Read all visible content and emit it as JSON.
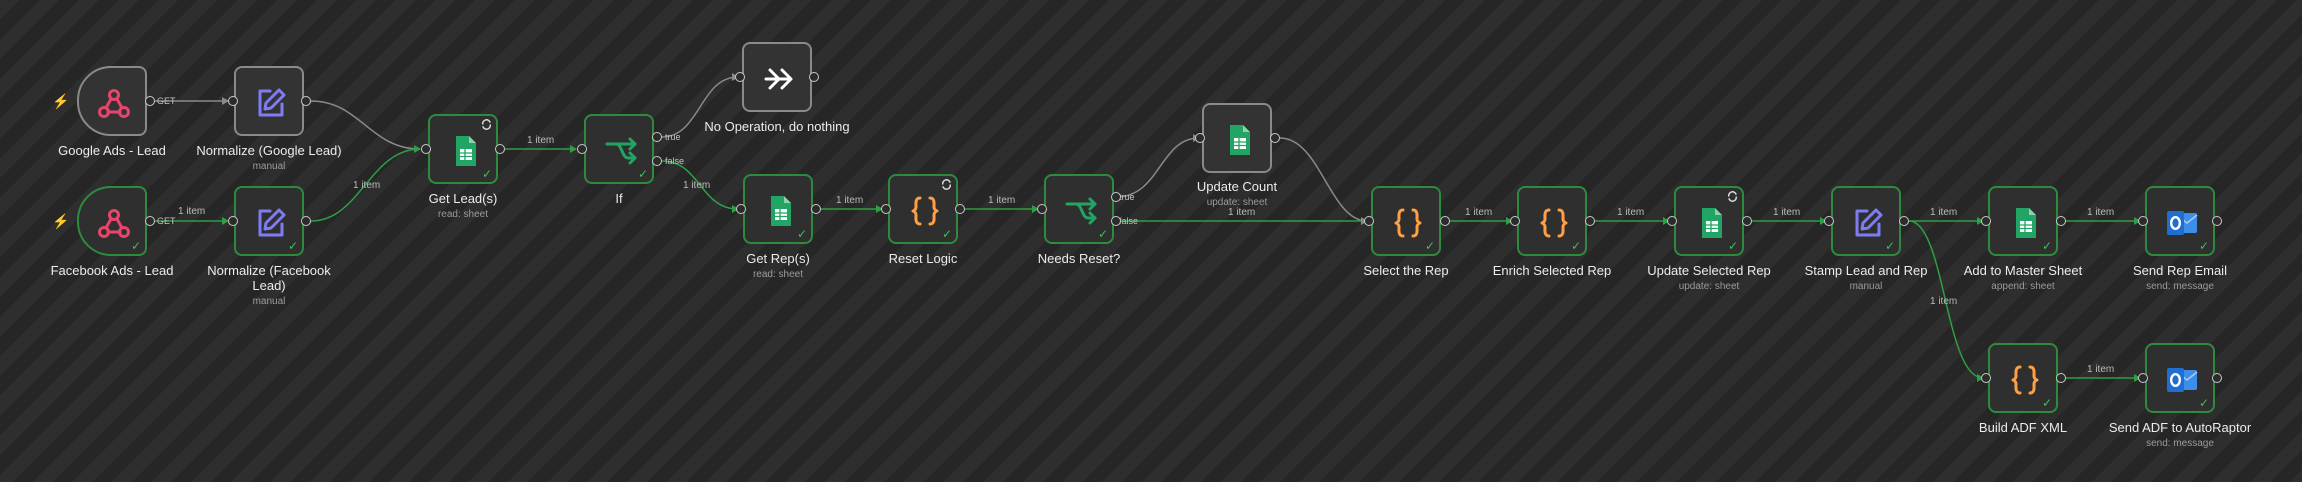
{
  "nodes": {
    "google_ads_lead": {
      "title": "Google Ads - Lead",
      "icon": "webhook-icon"
    },
    "normalize_google": {
      "title": "Normalize (Google Lead)",
      "subtitle": "manual",
      "icon": "edit-icon"
    },
    "facebook_ads_lead": {
      "title": "Facebook Ads - Lead",
      "icon": "webhook-icon"
    },
    "normalize_facebook": {
      "title": "Normalize (Facebook Lead)",
      "subtitle": "manual",
      "icon": "edit-icon"
    },
    "get_leads": {
      "title": "Get Lead(s)",
      "subtitle": "read: sheet",
      "icon": "google-sheets-icon"
    },
    "if": {
      "title": "If",
      "icon": "if-branch-icon"
    },
    "no_operation": {
      "title": "No Operation, do nothing",
      "icon": "arrow-forward-icon"
    },
    "get_reps": {
      "title": "Get Rep(s)",
      "subtitle": "read: sheet",
      "icon": "google-sheets-icon"
    },
    "reset_logic": {
      "title": "Reset Logic",
      "icon": "code-braces-icon"
    },
    "needs_reset": {
      "title": "Needs Reset?",
      "icon": "if-branch-icon"
    },
    "update_count": {
      "title": "Update Count",
      "subtitle": "update: sheet",
      "icon": "google-sheets-icon"
    },
    "select_rep": {
      "title": "Select the Rep",
      "icon": "code-braces-icon"
    },
    "enrich_rep": {
      "title": "Enrich Selected Rep",
      "icon": "code-braces-icon"
    },
    "update_selected_rep": {
      "title": "Update Selected Rep",
      "subtitle": "update: sheet",
      "icon": "google-sheets-icon"
    },
    "stamp_lead": {
      "title": "Stamp Lead and Rep",
      "subtitle": "manual",
      "icon": "edit-icon"
    },
    "add_master": {
      "title": "Add to Master Sheet",
      "subtitle": "append: sheet",
      "icon": "google-sheets-icon"
    },
    "send_rep_email": {
      "title": "Send Rep Email",
      "subtitle": "send: message",
      "icon": "outlook-icon"
    },
    "build_adf": {
      "title": "Build ADF XML",
      "icon": "code-braces-icon"
    },
    "send_adf": {
      "title": "Send ADF to AutoRaptor",
      "subtitle": "send: message",
      "icon": "outlook-icon"
    }
  },
  "ports": {
    "get_label": "GET",
    "true_label": "true",
    "false_label": "false"
  },
  "edges": {
    "item_label": "1 item"
  },
  "colors": {
    "success": "#2e8b3e",
    "edge_active": "#2f9e44",
    "edge_idle": "#8a8a8a",
    "sheets_green": "#21a464",
    "code_orange": "#ff9f43",
    "edit_purple": "#7e7cf5",
    "webhook_pink": "#e8456b",
    "trigger_orange": "#ff6d2e",
    "outlook_blue": "#1e6fd1"
  }
}
